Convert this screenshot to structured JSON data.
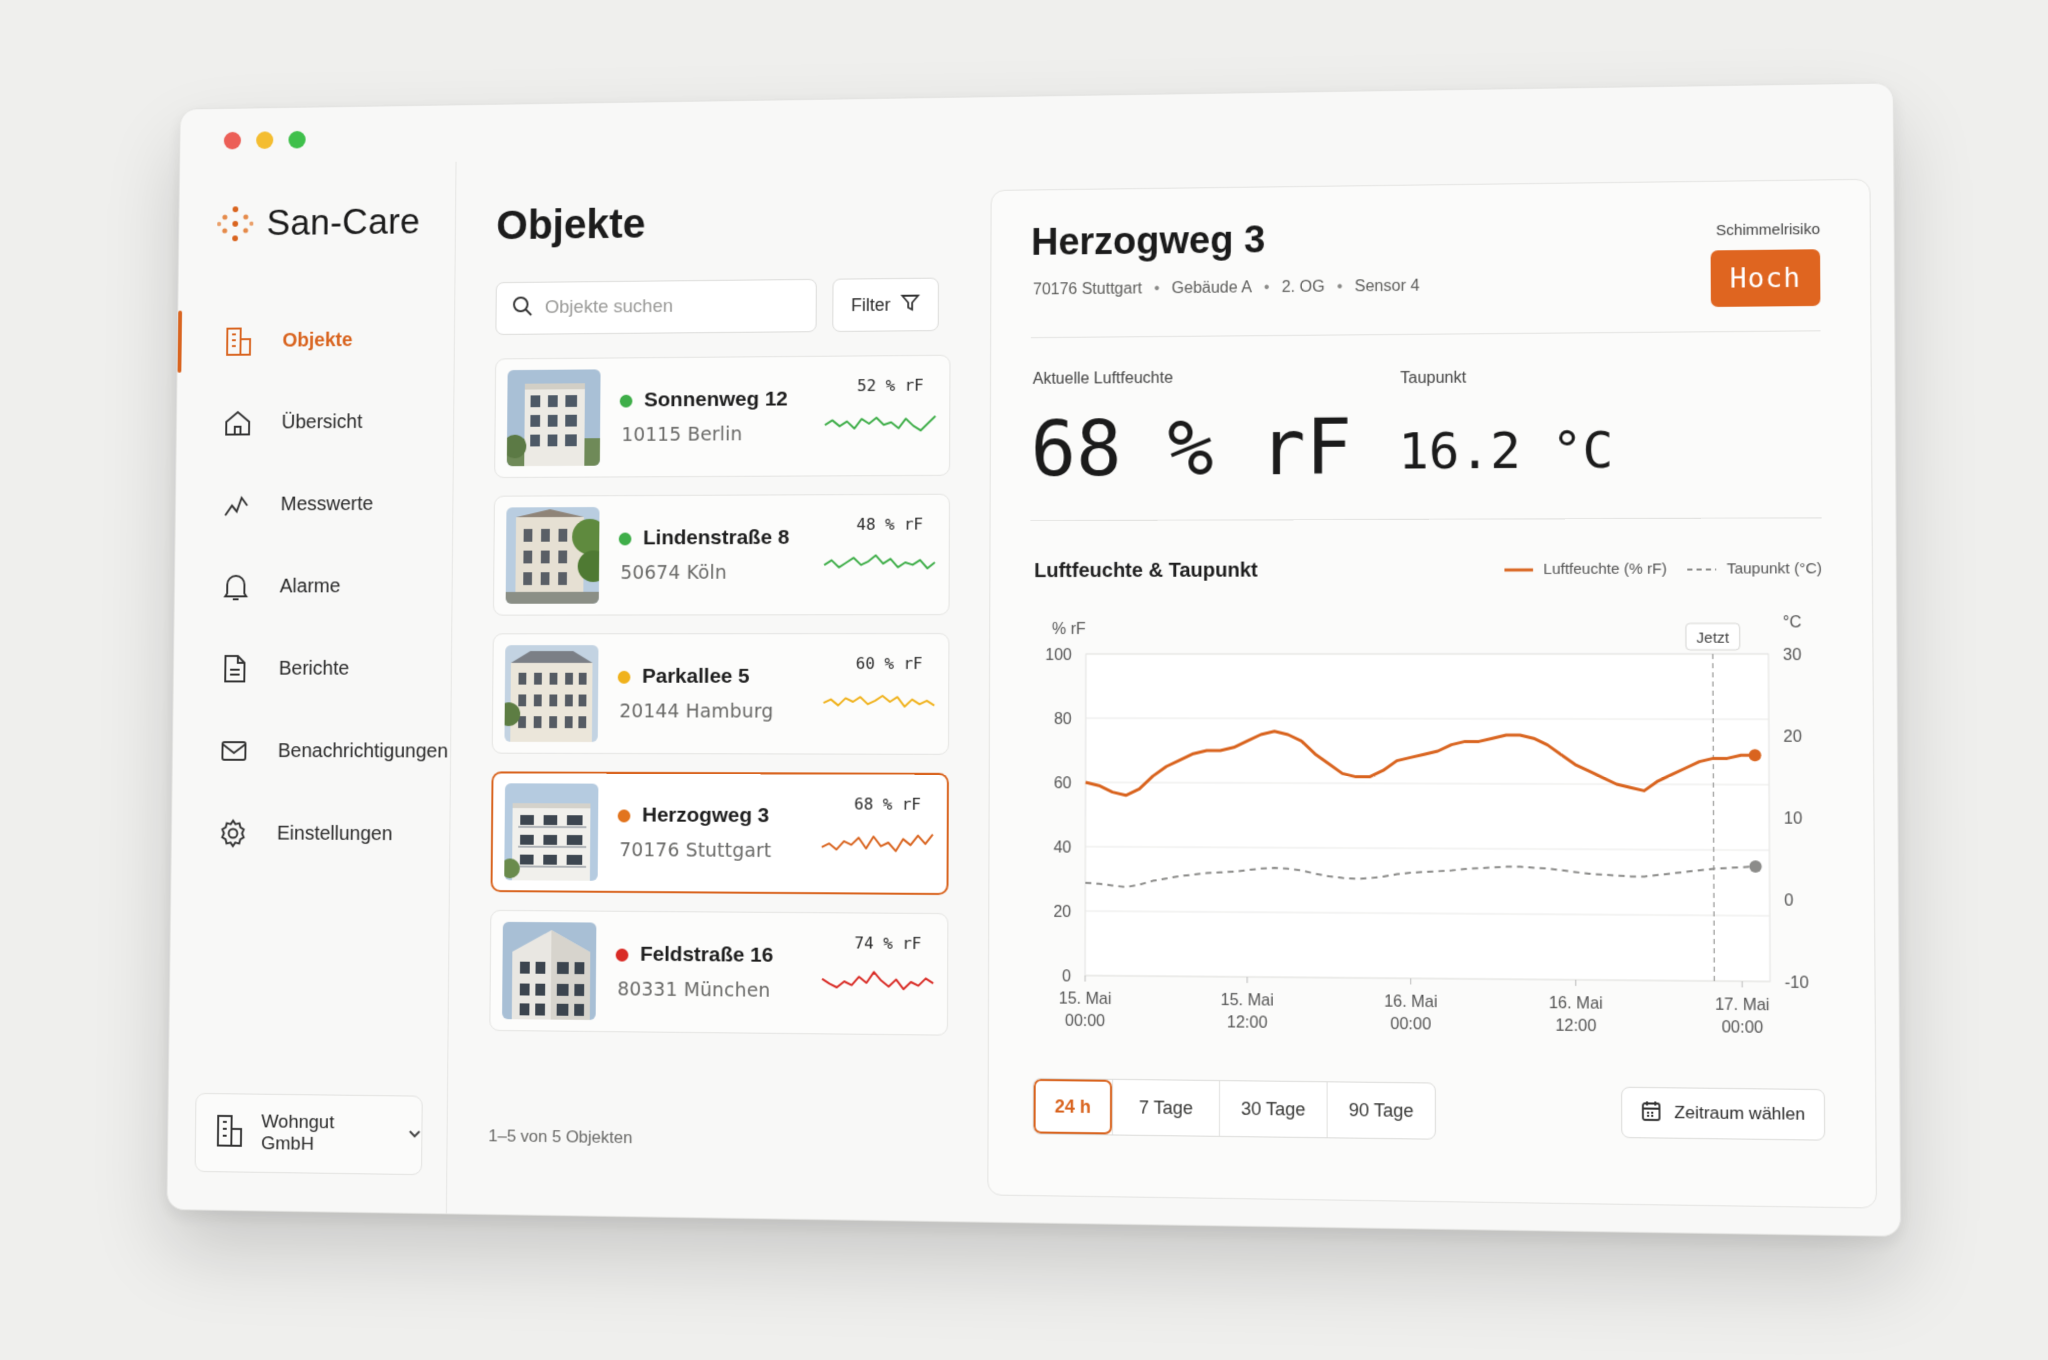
{
  "app": {
    "name": "San-Care"
  },
  "sidebar": {
    "items": [
      {
        "label": "Objekte",
        "icon": "building-icon",
        "active": true
      },
      {
        "label": "Übersicht",
        "icon": "home-icon",
        "active": false
      },
      {
        "label": "Messwerte",
        "icon": "line-chart-icon",
        "active": false
      },
      {
        "label": "Alarme",
        "icon": "bell-icon",
        "active": false
      },
      {
        "label": "Berichte",
        "icon": "document-icon",
        "active": false
      },
      {
        "label": "Benachrichtigungen",
        "icon": "mail-icon",
        "active": false
      },
      {
        "label": "Einstellungen",
        "icon": "gear-icon",
        "active": false
      }
    ],
    "organization": "Wohngut GmbH"
  },
  "objects": {
    "title": "Objekte",
    "search_placeholder": "Objekte suchen",
    "filter_label": "Filter",
    "items": [
      {
        "name": "Sonnenweg 12",
        "address": "10115 Berlin",
        "value": "52 % rF",
        "status_color": "#3fae49",
        "spark_color": "#3fae49",
        "spark": [
          0.55,
          0.35,
          0.6,
          0.4,
          0.7,
          0.3,
          0.5,
          0.25,
          0.55,
          0.45,
          0.7,
          0.3,
          0.6,
          0.8,
          0.5,
          0.2
        ]
      },
      {
        "name": "Lindenstraße 8",
        "address": "50674 Köln",
        "value": "48 % rF",
        "status_color": "#3fae49",
        "spark_color": "#3fae49",
        "spark": [
          0.6,
          0.4,
          0.7,
          0.5,
          0.3,
          0.6,
          0.45,
          0.2,
          0.55,
          0.35,
          0.7,
          0.5,
          0.6,
          0.4,
          0.75,
          0.5
        ]
      },
      {
        "name": "Parkallee 5",
        "address": "20144 Hamburg",
        "value": "60 % rF",
        "status_color": "#f0b21c",
        "spark_color": "#f0b21c",
        "spark": [
          0.55,
          0.4,
          0.65,
          0.35,
          0.5,
          0.3,
          0.6,
          0.45,
          0.25,
          0.5,
          0.3,
          0.7,
          0.4,
          0.6,
          0.45,
          0.65
        ]
      },
      {
        "name": "Herzogweg 3",
        "address": "70176 Stuttgart",
        "value": "68 % rF",
        "status_color": "#e2741e",
        "spark_color": "#d9641f",
        "spark": [
          0.7,
          0.55,
          0.8,
          0.45,
          0.6,
          0.3,
          0.75,
          0.25,
          0.65,
          0.5,
          0.85,
          0.35,
          0.6,
          0.2,
          0.55,
          0.15
        ]
      },
      {
        "name": "Feldstraße 16",
        "address": "80331 München",
        "value": "74 % rF",
        "status_color": "#d92b25",
        "spark_color": "#d92b25",
        "spark": [
          0.4,
          0.6,
          0.75,
          0.5,
          0.65,
          0.3,
          0.55,
          0.1,
          0.45,
          0.7,
          0.4,
          0.8,
          0.5,
          0.65,
          0.35,
          0.55
        ]
      }
    ],
    "selected_index": 3,
    "footer": "1–5 von 5 Objekten"
  },
  "detail": {
    "title": "Herzogweg 3",
    "meta": [
      "70176 Stuttgart",
      "Gebäude A",
      "2. OG",
      "Sensor 4"
    ],
    "meta_separator": "•",
    "risk_label": "Schimmelrisiko",
    "risk_value": "Hoch",
    "humidity_label": "Aktuelle Luftfeuchte",
    "humidity_value": "68 % rF",
    "dewpoint_label": "Taupunkt",
    "dewpoint_value": "16.2 °C",
    "chart_title": "Luftfeuchte & Taupunkt",
    "legend_humidity": "Luftfeuchte (% rF)",
    "legend_dewpoint": "Taupunkt (°C)",
    "ranges": [
      "24 h",
      "7 Tage",
      "30 Tage",
      "90 Tage"
    ],
    "active_range": 0,
    "period_button": "Zeitraum wählen"
  },
  "colors": {
    "accent": "#d9641f",
    "dewpoint": "#8c8c8a",
    "grid": "#e6e6e4"
  },
  "chart_data": {
    "type": "line",
    "x": [
      0,
      2,
      4,
      6,
      8,
      10,
      12,
      14,
      16,
      18,
      20,
      22,
      24,
      26,
      28,
      30,
      32,
      34,
      36,
      38,
      40,
      42,
      44,
      46,
      48,
      50,
      52,
      54,
      56,
      58,
      60,
      62,
      64,
      66,
      68,
      70,
      72,
      74,
      76,
      78,
      80,
      82,
      84,
      86,
      88,
      90,
      92,
      94,
      96,
      98
    ],
    "x_ticks": [
      {
        "at": 0,
        "label_line1": "15. Mai",
        "label_line2": "00:00"
      },
      {
        "at": 24,
        "label_line1": "15. Mai",
        "label_line2": "12:00"
      },
      {
        "at": 48,
        "label_line1": "16. Mai",
        "label_line2": "00:00"
      },
      {
        "at": 72,
        "label_line1": "16. Mai",
        "label_line2": "12:00"
      },
      {
        "at": 96,
        "label_line1": "17. Mai",
        "label_line2": "00:00"
      }
    ],
    "x_range": [
      0,
      100
    ],
    "now_at": 92,
    "now_label": "Jetzt",
    "y_left": {
      "label": "% rF",
      "ticks": [
        0,
        20,
        40,
        60,
        80,
        100
      ],
      "range": [
        0,
        100
      ]
    },
    "y_right": {
      "label": "°C",
      "ticks": [
        -10,
        0,
        10,
        20,
        30
      ],
      "range": [
        -10,
        30
      ]
    },
    "series": [
      {
        "name": "Luftfeuchte (% rF)",
        "axis": "left",
        "color": "#d9641f",
        "style": "solid",
        "values": [
          60,
          59,
          57,
          56,
          58,
          62,
          65,
          67,
          69,
          70,
          70,
          71,
          73,
          75,
          76,
          75,
          73,
          69,
          66,
          63,
          62,
          62,
          64,
          67,
          68,
          69,
          70,
          72,
          73,
          73,
          74,
          75,
          75,
          74,
          72,
          69,
          66,
          64,
          62,
          60,
          59,
          58,
          61,
          63,
          65,
          67,
          68,
          68,
          69,
          69
        ]
      },
      {
        "name": "Taupunkt (°C)",
        "axis": "right",
        "color": "#8c8c8a",
        "style": "dashed",
        "values": [
          1.5,
          1.4,
          1.2,
          1.0,
          1.3,
          1.8,
          2.1,
          2.4,
          2.6,
          2.8,
          2.9,
          3.0,
          3.2,
          3.4,
          3.5,
          3.4,
          3.2,
          2.8,
          2.5,
          2.3,
          2.2,
          2.3,
          2.5,
          2.8,
          3.0,
          3.1,
          3.2,
          3.3,
          3.5,
          3.6,
          3.7,
          3.8,
          3.8,
          3.7,
          3.6,
          3.4,
          3.2,
          3.0,
          2.9,
          2.8,
          2.7,
          2.7,
          2.9,
          3.1,
          3.3,
          3.5,
          3.7,
          3.8,
          3.9,
          4.0
        ]
      }
    ],
    "grid": true,
    "legend_position": "top-right"
  }
}
